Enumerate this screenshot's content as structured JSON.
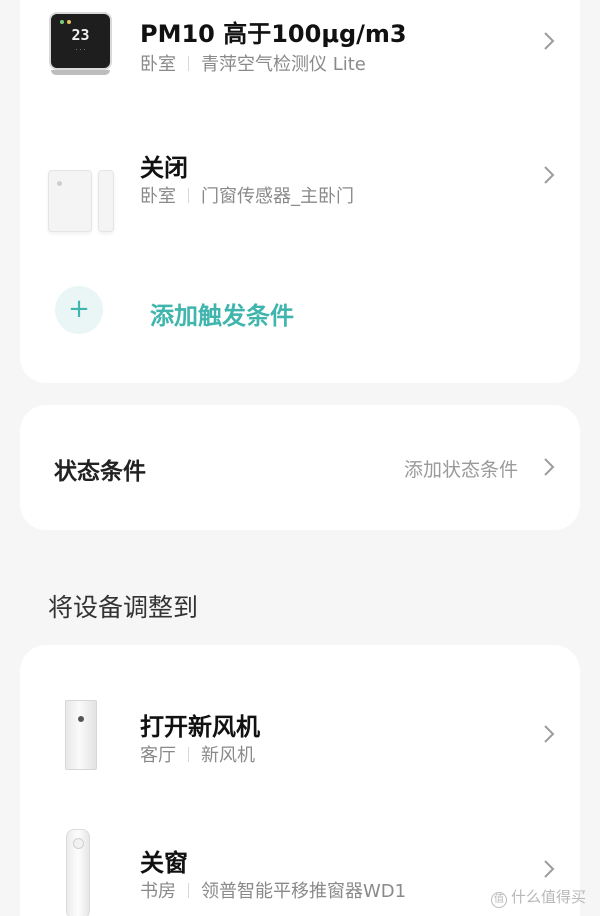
{
  "triggers": {
    "items": [
      {
        "title": "PM10 高于100μg/m3",
        "room": "卧室",
        "device": "青萍空气检测仪 Lite",
        "icon": "air-quality-monitor-icon",
        "screen_value": "23"
      },
      {
        "title": "关闭",
        "room": "卧室",
        "device": "门窗传感器_主卧门",
        "icon": "door-window-sensor-icon"
      }
    ],
    "add_label": "添加触发条件",
    "add_icon": "plus-icon"
  },
  "state_conditions": {
    "title": "状态条件",
    "action": "添加状态条件"
  },
  "actions": {
    "heading": "将设备调整到",
    "items": [
      {
        "title": "打开新风机",
        "room": "客厅",
        "device": "新风机",
        "icon": "fresh-air-unit-icon"
      },
      {
        "title": "关窗",
        "room": "书房",
        "device": "领普智能平移推窗器WD1",
        "icon": "window-pusher-icon"
      }
    ]
  },
  "watermark": {
    "badge": "值",
    "text": "什么值得买"
  },
  "colors": {
    "accent": "#3fb5ad",
    "background": "#f6f6f6",
    "card": "#ffffff",
    "muted_text": "#8a8a8a"
  }
}
